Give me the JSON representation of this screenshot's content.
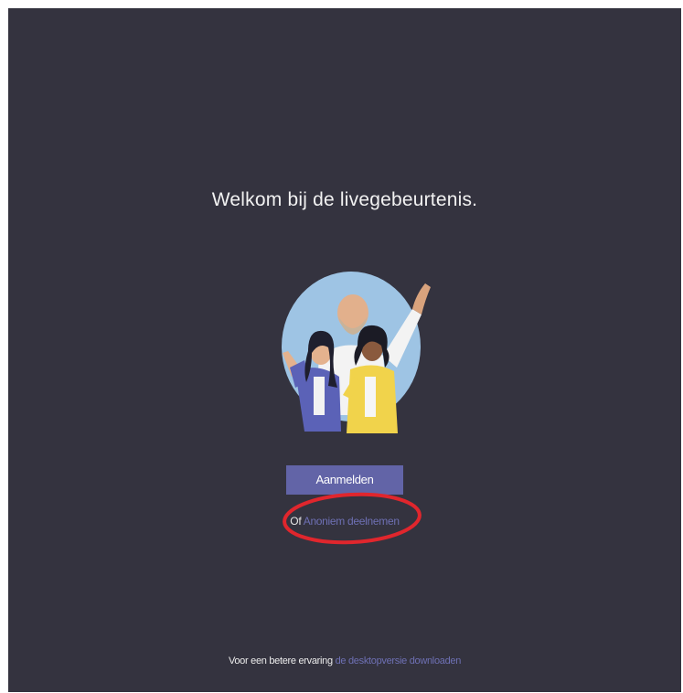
{
  "welcome": {
    "title": "Welkom bij de livegebeurtenis."
  },
  "illustration": {
    "icon": "people-waving-illustration"
  },
  "signin": {
    "label": "Aanmelden"
  },
  "anonymous": {
    "prefix": "Of",
    "link_label": "Anoniem deelnemen"
  },
  "footer": {
    "text": "Voor een betere ervaring",
    "link_label": "de desktopversie downloaden"
  },
  "colors": {
    "background": "#34333f",
    "accent": "#6264a7",
    "link": "#6e70b4",
    "highlight_annotation": "#e0262d"
  }
}
